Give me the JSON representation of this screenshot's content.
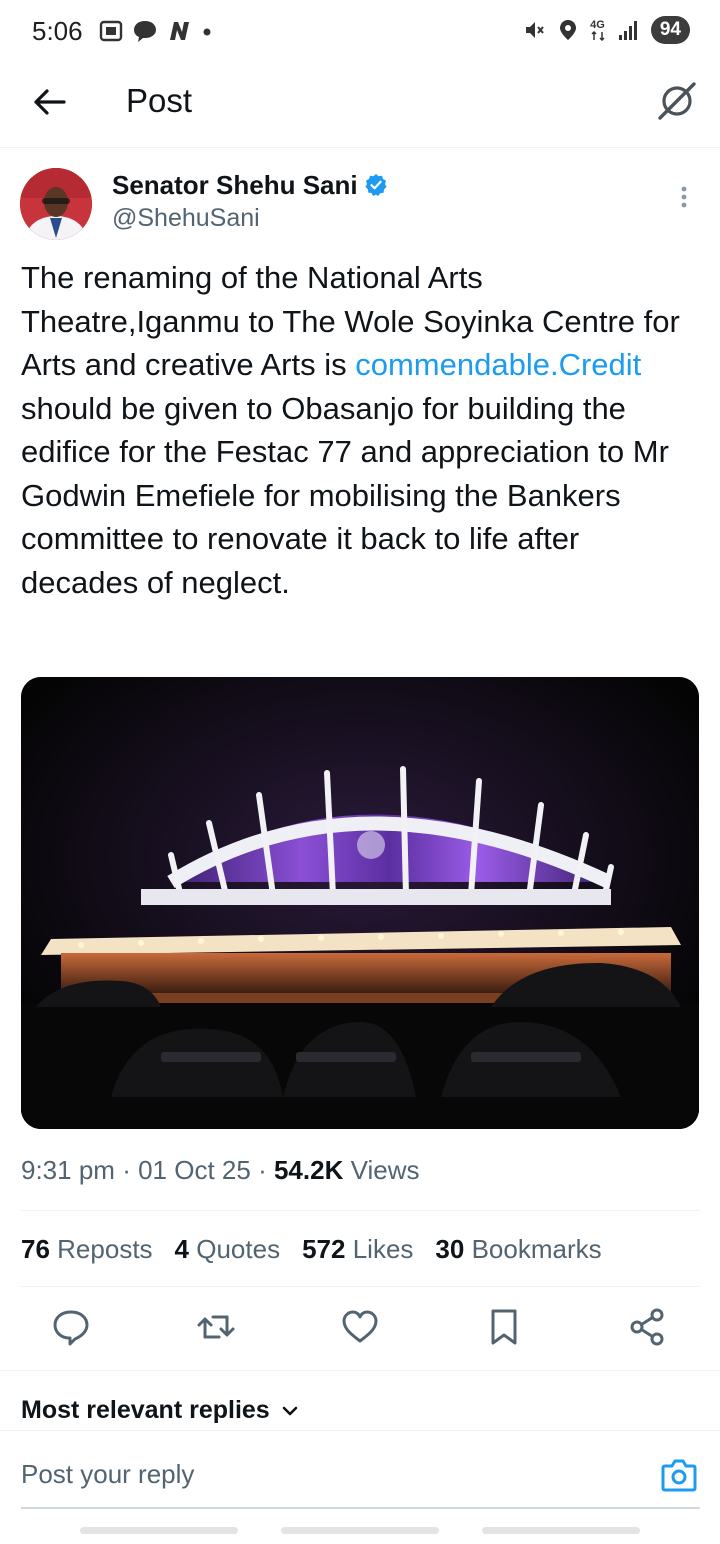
{
  "status_bar": {
    "time": "5:06",
    "left_icons": [
      "screenshot-icon",
      "chat-bubble-icon",
      "n-app-icon",
      "dot-icon"
    ],
    "right_icons": [
      "vibrate-icon",
      "location-icon",
      "network-4g-icon",
      "signal-icon"
    ],
    "network_label": "4G",
    "battery": "94"
  },
  "header": {
    "title": "Post",
    "back_icon": "arrow-left-icon",
    "grok_icon": "grok-icon"
  },
  "author": {
    "name": "Senator Shehu Sani",
    "handle": "@ShehuSani",
    "verified_color": "#1d9bf0"
  },
  "tweet": {
    "text_before_link": "The renaming of the National Arts Theatre,Iganmu to The Wole Soyinka Centre for Arts and creative Arts is ",
    "link_text": "commendable.Credit",
    "text_after_link": " should be given to Obasanjo for building the edifice for the Festac 77 and appreciation to Mr Godwin Emefiele for mobilising the Bankers committee to renovate it back to life after decades of neglect."
  },
  "meta": {
    "time": "9:31 pm",
    "separator": "·",
    "date": "01 Oct 25",
    "views_count": "54.2K",
    "views_label": "Views"
  },
  "stats": [
    {
      "count": "76",
      "label": "Reposts"
    },
    {
      "count": "4",
      "label": "Quotes"
    },
    {
      "count": "572",
      "label": "Likes"
    },
    {
      "count": "30",
      "label": "Bookmarks"
    }
  ],
  "actions": [
    "reply-icon",
    "repost-icon",
    "like-icon",
    "bookmark-icon",
    "share-icon"
  ],
  "replies_filter": {
    "label": "Most relevant replies"
  },
  "reply": {
    "placeholder": "Post your reply"
  },
  "colors": {
    "accent": "#1d9bf0",
    "text": "#0f1419",
    "muted": "#536471",
    "divider": "#eff3f4"
  }
}
